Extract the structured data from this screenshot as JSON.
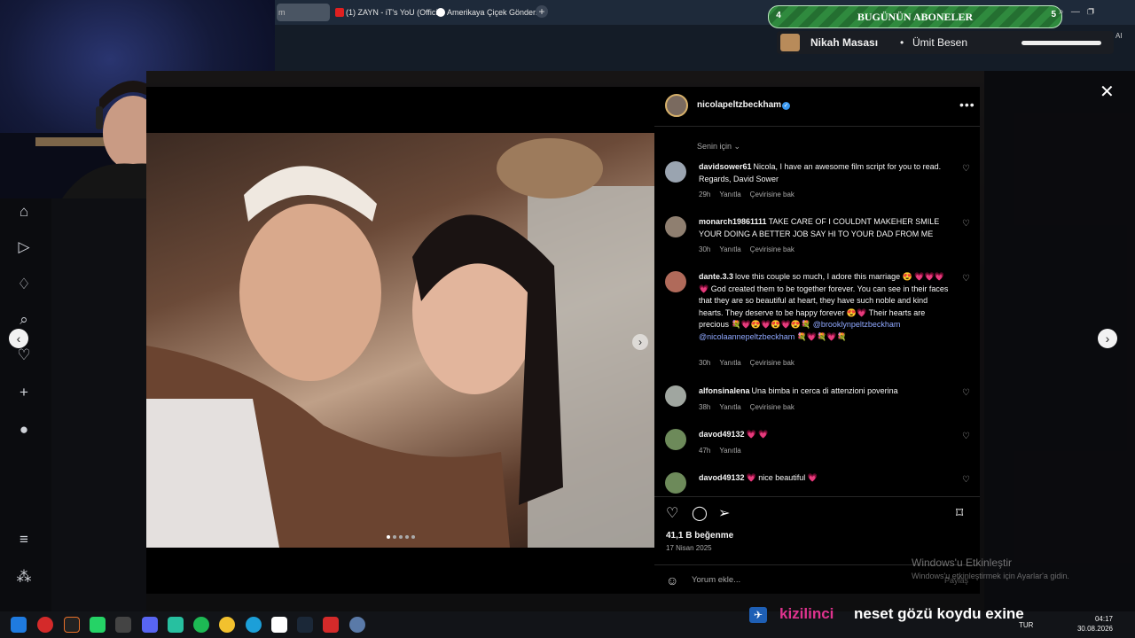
{
  "browser": {
    "tabs": [
      {
        "label": "m"
      },
      {
        "label": "(1) ZAYN - iT's YoU (Offici"
      },
      {
        "label": "Amerikaya Çiçek Gönderm"
      }
    ],
    "new_tab": "+"
  },
  "stream": {
    "subs_left": "4",
    "subs_title": "BUGÜNÜN ABONELER",
    "subs_right": "5",
    "music_title": "Nikah Masası",
    "music_sep": "•",
    "music_artist": "Ümit Besen",
    "ai_label": "AI",
    "chat_user": "kizilinci",
    "chat_message": "neset gözü koydu exine"
  },
  "post": {
    "username": "nicolapeltzbeckham",
    "more_icon": "•••",
    "filter_label": "Senin için ⌄",
    "comments": [
      {
        "user": "davidsower61",
        "text": "Nicola, I have an awesome film script for you to read. Regards, David Sower",
        "age": "29h",
        "reply": "Yanıtla",
        "translate": "Çevirisine bak"
      },
      {
        "user": "monarch19861111",
        "text": "TAKE CARE OF I COULDNT MAKEHER SMILE YOUR DOING A BETTER JOB SAY HI TO YOUR DAD FROM ME",
        "age": "30h",
        "reply": "Yanıtla",
        "translate": "Çevirisine bak"
      },
      {
        "user": "dante.3.3",
        "text": "love this couple so much, I adore this marriage 😍 💗💗💗💗 God created them to be together forever. You can see in their faces that they are so beautiful at heart, they have such noble and kind hearts. They deserve to be happy forever 😍💗 Their hearts are precious 💐💗😍💗😍💗😍💐",
        "mentions": "@brooklynpeltzbeckham @nicolaannepeltzbeckham",
        "tail": "💐💗💐💗💐",
        "age": "30h",
        "reply": "Yanıtla",
        "translate": "Çevirisine bak"
      },
      {
        "user": "alfonsinalena",
        "text": "Una bimba in cerca di attenzioni poverina",
        "age": "38h",
        "reply": "Yanıtla",
        "translate": "Çevirisine bak"
      },
      {
        "user": "davod49132",
        "text": "💗 💗",
        "age": "47h",
        "reply": "Yanıtla"
      },
      {
        "user": "davod49132",
        "text": "💗 nice beautiful 💗"
      }
    ],
    "likes": "41,1 B beğenme",
    "date": "17 Nisan 2025",
    "comment_placeholder": "Yorum ekle...",
    "share_label": "Paylaş"
  },
  "watermark": {
    "line1": "Windows'u Etkinleştir",
    "line2": "Windows'u etkinleştirmek için Ayarlar'a gidin."
  },
  "taskbar": {
    "lang": "TUR",
    "time": "04:17",
    "date": "30.08.2026"
  },
  "icons": {
    "close": "✕",
    "nav_prev": "‹",
    "nav_next": "›"
  },
  "colors": {
    "accent_green": "#2f8a3e",
    "instagram_bg": "#000000",
    "chat_user": "#e0338f",
    "mention": "#8fa8ff"
  }
}
